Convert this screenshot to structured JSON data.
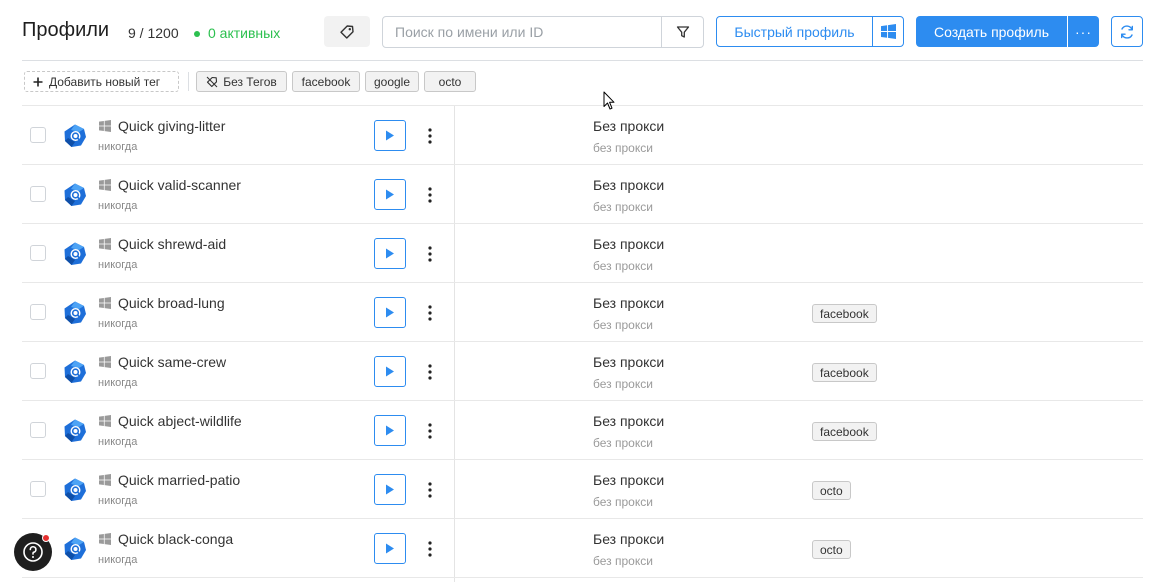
{
  "header": {
    "title": "Профили",
    "count": "9 / 1200",
    "active": "0 активных",
    "search_placeholder": "Поиск по имени или ID",
    "quick_profile": "Быстрый профиль",
    "create_profile": "Создать профиль",
    "more": "···"
  },
  "tagbar": {
    "add_tag": "Добавить новый тег",
    "chips": [
      "Без Тегов",
      "facebook",
      "google",
      "octo"
    ]
  },
  "colors": {
    "accent": "#2d8cf0",
    "active_green": "#2cc04f",
    "notification_red": "#e5302f"
  },
  "rows": [
    {
      "name": "Quick giving-litter",
      "last": "никогда",
      "proxy": "Без прокси",
      "proxy_sub": "без прокси",
      "tag": ""
    },
    {
      "name": "Quick valid-scanner",
      "last": "никогда",
      "proxy": "Без прокси",
      "proxy_sub": "без прокси",
      "tag": ""
    },
    {
      "name": "Quick shrewd-aid",
      "last": "никогда",
      "proxy": "Без прокси",
      "proxy_sub": "без прокси",
      "tag": ""
    },
    {
      "name": "Quick broad-lung",
      "last": "никогда",
      "proxy": "Без прокси",
      "proxy_sub": "без прокси",
      "tag": "facebook"
    },
    {
      "name": "Quick same-crew",
      "last": "никогда",
      "proxy": "Без прокси",
      "proxy_sub": "без прокси",
      "tag": "facebook"
    },
    {
      "name": "Quick abject-wildlife",
      "last": "никогда",
      "proxy": "Без прокси",
      "proxy_sub": "без прокси",
      "tag": "facebook"
    },
    {
      "name": "Quick married-patio",
      "last": "никогда",
      "proxy": "Без прокси",
      "proxy_sub": "без прокси",
      "tag": "octo"
    },
    {
      "name": "Quick black-conga",
      "last": "никогда",
      "proxy": "Без прокси",
      "proxy_sub": "без прокси",
      "tag": "octo"
    }
  ],
  "icons": {
    "tag": "tag-icon",
    "filter": "filter-icon",
    "windows": "windows-icon",
    "refresh": "refresh-icon",
    "add": "plus-icon",
    "no_tag": "tag-off-icon",
    "browser": "browser-icon",
    "play": "play-icon",
    "kebab": "kebab-icon",
    "help": "help-icon"
  }
}
